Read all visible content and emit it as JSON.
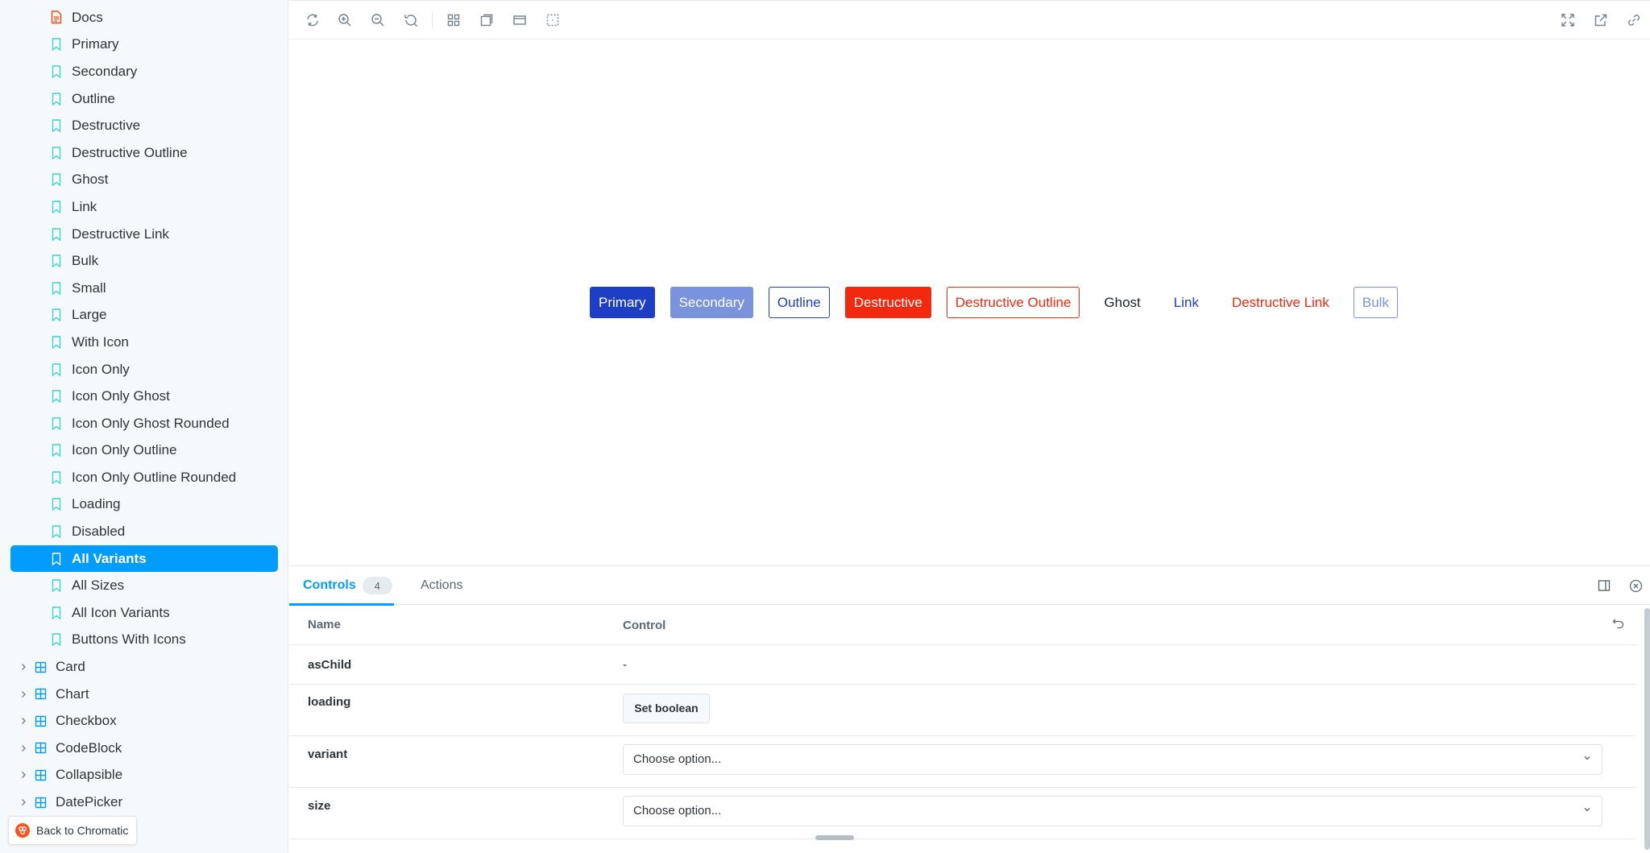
{
  "sidebar": {
    "doc_item": {
      "label": "Docs"
    },
    "stories": [
      "Primary",
      "Secondary",
      "Outline",
      "Destructive",
      "Destructive Outline",
      "Ghost",
      "Link",
      "Destructive Link",
      "Bulk",
      "Small",
      "Large",
      "With Icon",
      "Icon Only",
      "Icon Only Ghost",
      "Icon Only Ghost Rounded",
      "Icon Only Outline",
      "Icon Only Outline Rounded",
      "Loading",
      "Disabled",
      "All Variants",
      "All Sizes",
      "All Icon Variants",
      "Buttons With Icons"
    ],
    "selected_story": "All Variants",
    "components": [
      "Card",
      "Chart",
      "Checkbox",
      "CodeBlock",
      "Collapsible",
      "DatePicker"
    ],
    "back_to_chromatic": "Back to Chromatic"
  },
  "preview": {
    "buttons": {
      "primary": "Primary",
      "secondary": "Secondary",
      "outline": "Outline",
      "destructive": "Destructive",
      "destructive_outline": "Destructive Outline",
      "ghost": "Ghost",
      "link": "Link",
      "destructive_link": "Destructive Link",
      "bulk": "Bulk"
    }
  },
  "panel": {
    "tabs": {
      "controls": "Controls",
      "controls_count": "4",
      "actions": "Actions"
    },
    "table": {
      "header_name": "Name",
      "header_control": "Control",
      "rows": {
        "aschild": {
          "name": "asChild",
          "value": "-"
        },
        "loading": {
          "name": "loading",
          "button": "Set boolean"
        },
        "variant": {
          "name": "variant",
          "placeholder": "Choose option..."
        },
        "size": {
          "name": "size",
          "placeholder": "Choose option..."
        }
      }
    }
  },
  "colors": {
    "accent": "#029cfd",
    "primary": "#1e3fc4",
    "secondary": "#7b93dc",
    "destructive": "#f0290f",
    "story_icon": "#37d5d3",
    "component_icon": "#029cfd",
    "doc_icon": "#ff4400"
  }
}
